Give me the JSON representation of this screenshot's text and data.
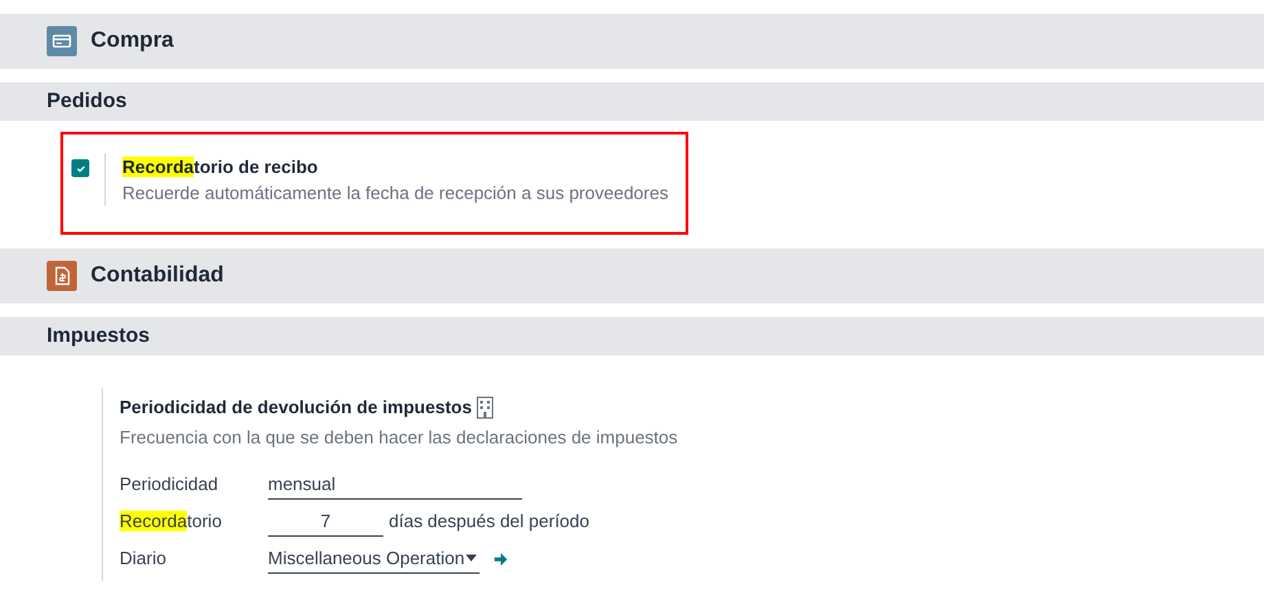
{
  "apps": [
    {
      "title": "Compra",
      "sections": [
        {
          "title": "Pedidos",
          "settings": [
            {
              "kind": "checkbox",
              "checked": true,
              "title": {
                "highlight": "Recorda",
                "rest": "torio de recibo"
              },
              "description": "Recuerde automáticamente la fecha de recepción a sus proveedores"
            }
          ]
        }
      ]
    },
    {
      "title": "Contabilidad",
      "sections": [
        {
          "title": "Impuestos",
          "settings": [
            {
              "kind": "form",
              "title": "Periodicidad de devolución de impuestos",
              "description": "Frecuencia con la que se deben hacer las declaraciones de impuestos",
              "fields": [
                {
                  "kind": "text",
                  "label": {
                    "rest": "Periodicidad"
                  },
                  "value": "mensual"
                },
                {
                  "kind": "number",
                  "label": {
                    "highlight": "Recorda",
                    "rest": "torio"
                  },
                  "value": "7",
                  "suffix": "días después del período"
                },
                {
                  "kind": "select",
                  "label": {
                    "rest": "Diario"
                  },
                  "value": "Miscellaneous Operation"
                }
              ]
            }
          ]
        }
      ]
    }
  ]
}
